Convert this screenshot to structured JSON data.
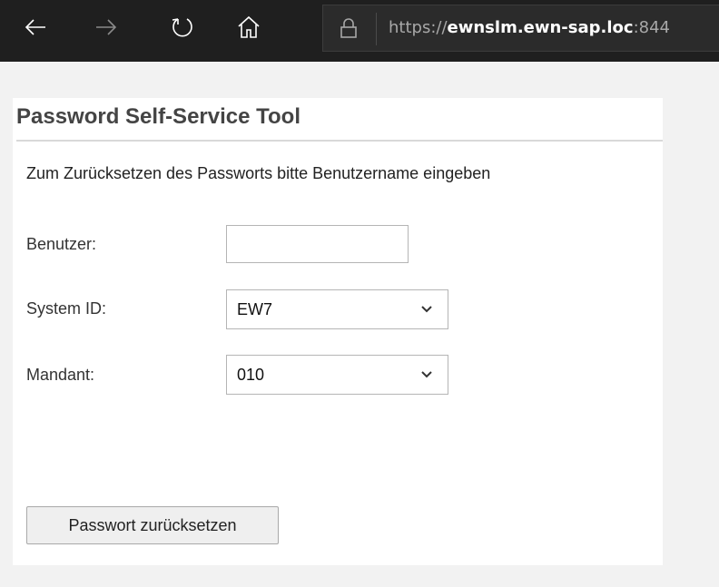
{
  "browser": {
    "url_prefix": "https://",
    "url_host": "ewnslm.ewn-sap.loc",
    "url_port": ":844",
    "icons": [
      "back-arrow-icon",
      "forward-arrow-icon",
      "refresh-icon",
      "home-icon",
      "lock-icon"
    ]
  },
  "page": {
    "title": "Password Self-Service Tool",
    "instruction": "Zum Zurücksetzen des Passworts bitte Benutzername eingeben"
  },
  "form": {
    "user": {
      "label": "Benutzer:",
      "value": ""
    },
    "system_id": {
      "label": "System ID:",
      "selected": "EW7"
    },
    "client": {
      "label": "Mandant:",
      "selected": "010"
    },
    "submit_label": "Passwort zurücksetzen"
  }
}
